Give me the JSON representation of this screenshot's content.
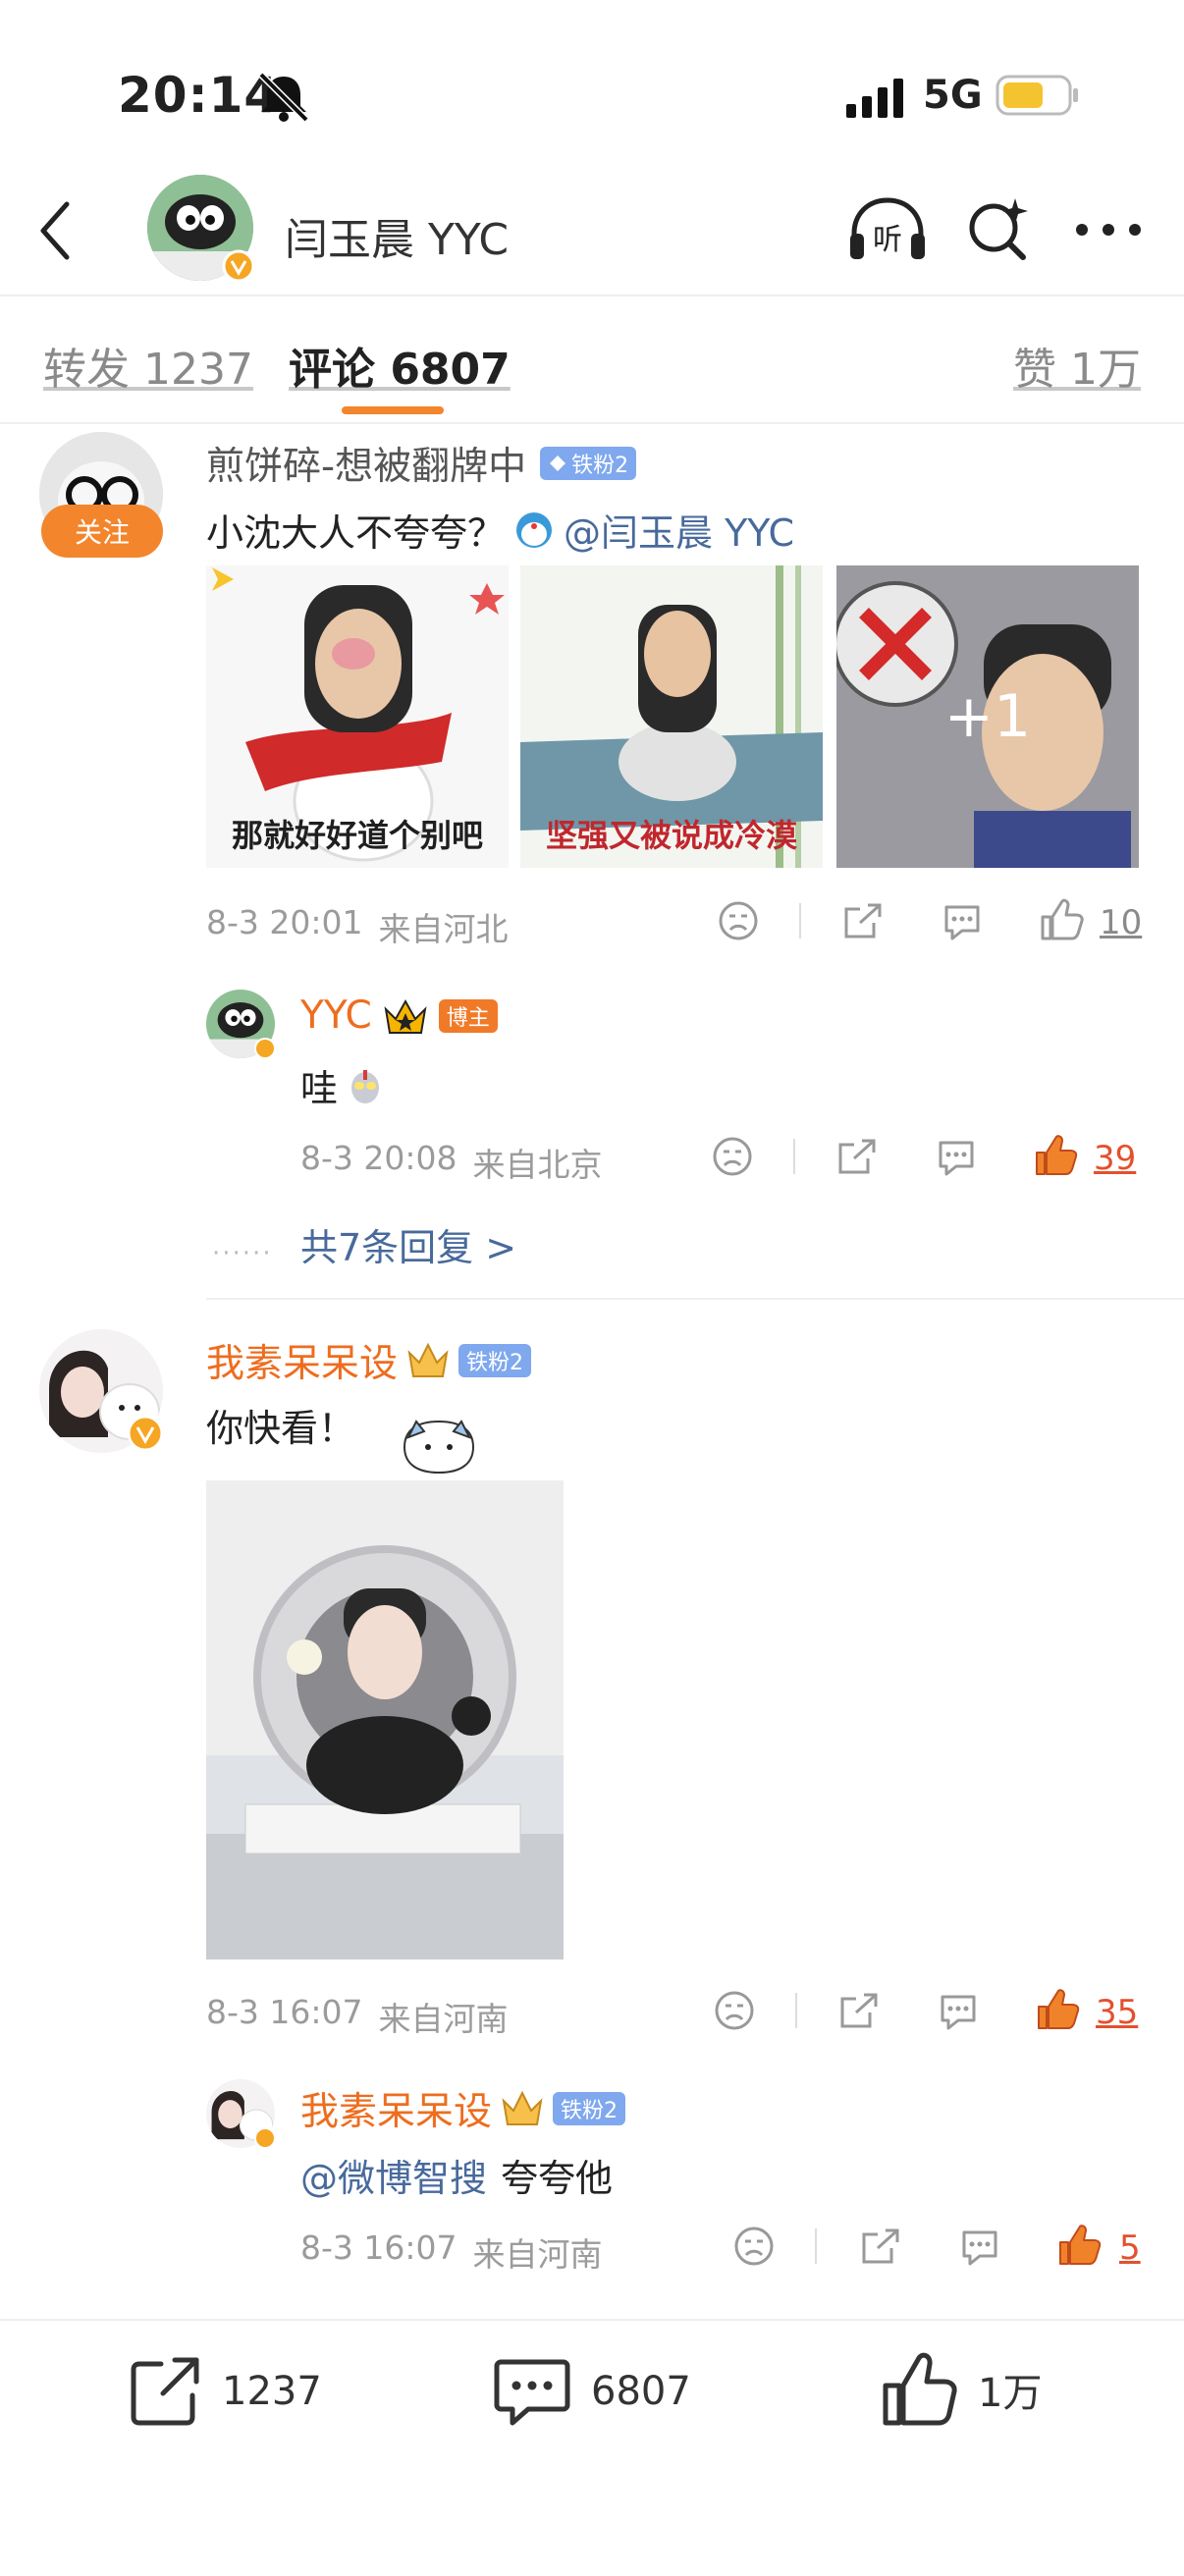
{
  "status_bar": {
    "time": "20:14",
    "network": "5G"
  },
  "header": {
    "title": "闫玉晨 YYC"
  },
  "tabs": {
    "reposts": "转发 1237",
    "comments": "评论 6807",
    "likes": "赞 1万"
  },
  "comments": [
    {
      "user": "煎饼碎-想被翻牌中",
      "fan_badge": "铁粉2",
      "follow_label": "关注",
      "text": "小沈大人不夸夸？",
      "mention": "@闫玉晨 YYC",
      "images": [
        {
          "caption": "那就好好道个别吧"
        },
        {
          "caption": "坚强又被说成冷漠"
        },
        {
          "overlay": "+1"
        }
      ],
      "date": "8-3 20:01",
      "location": "来自河北",
      "likes": "10",
      "reply": {
        "user": "YYC",
        "badge": "博主",
        "text": "哇",
        "date": "8-3 20:08",
        "location": "来自北京",
        "likes": "39"
      },
      "more_replies": "共7条回复 >"
    },
    {
      "user": "我素呆呆设",
      "fan_badge": "铁粉2",
      "text": "你快看！",
      "date": "8-3 16:07",
      "location": "来自河南",
      "likes": "35",
      "reply": {
        "user": "我素呆呆设",
        "fan_badge": "铁粉2",
        "mention": "@微博智搜",
        "text": "夸夸他",
        "date": "8-3 16:07",
        "location": "来自河南",
        "likes": "5"
      }
    }
  ],
  "bottom_bar": {
    "reposts": "1237",
    "comments": "6807",
    "likes": "1万"
  },
  "colors": {
    "accent_orange": "#ee6d1f",
    "like_red": "#e4502d",
    "mention_blue": "#486a9b",
    "fan_badge_blue": "#7fa8ee"
  }
}
